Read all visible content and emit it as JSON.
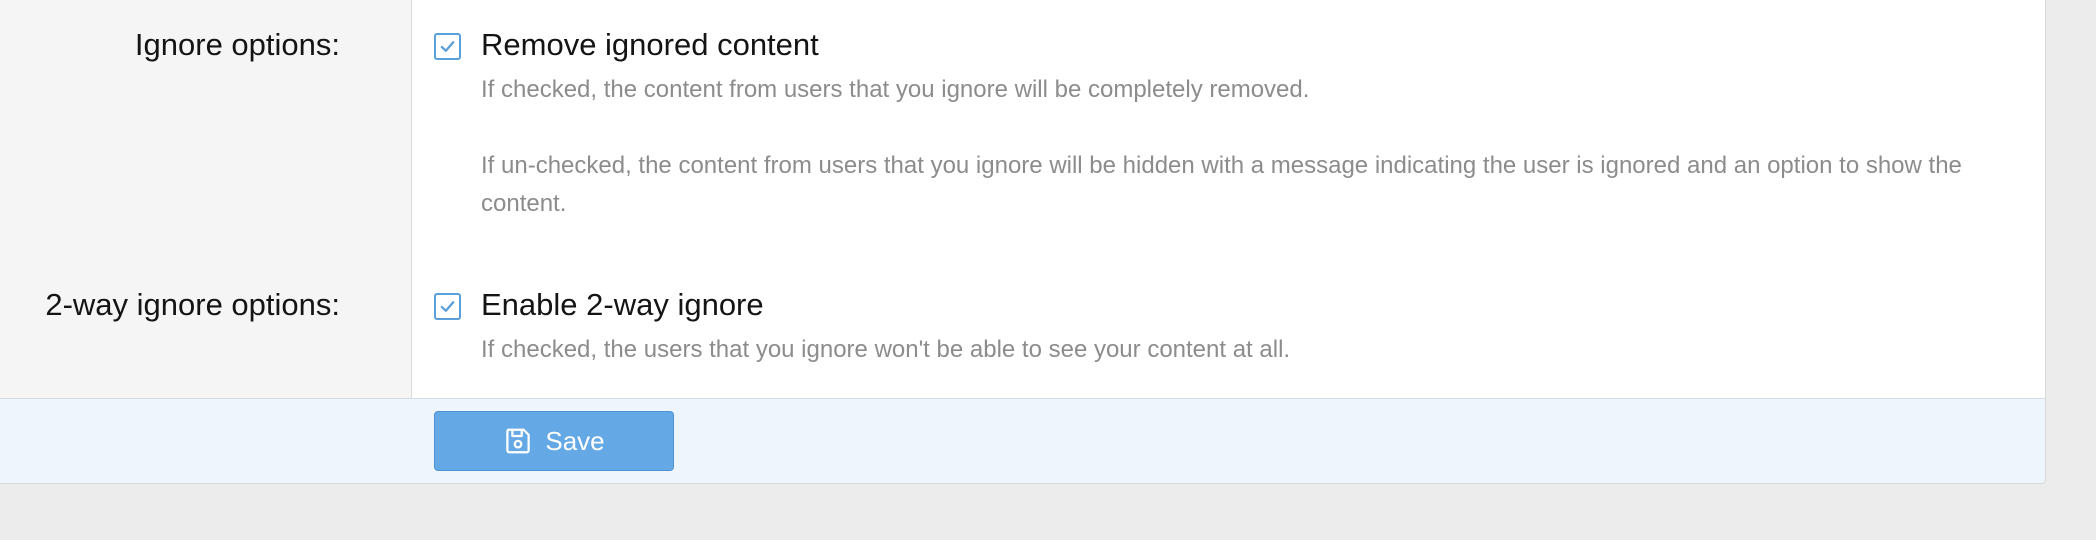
{
  "form": {
    "ignore_options": {
      "label": "Ignore options:",
      "checkbox_label": "Remove ignored content",
      "checked": true,
      "hint_checked": "If checked, the content from users that you ignore will be completely removed.",
      "hint_unchecked": "If un-checked, the content from users that you ignore will be hidden with a message indicating the user is ignored and an option to show the content."
    },
    "two_way_ignore": {
      "label": "2-way ignore options:",
      "checkbox_label": "Enable 2-way ignore",
      "checked": true,
      "hint": "If checked, the users that you ignore won't be able to see your content at all."
    }
  },
  "footer": {
    "save_label": "Save",
    "save_icon": "save-icon"
  },
  "colors": {
    "accent": "#64a8e6",
    "checkbox_border": "#5a9fd9",
    "hint_text": "#8c8c8c",
    "footer_bg": "#eef5fd",
    "label_col_bg": "#f5f5f5"
  }
}
